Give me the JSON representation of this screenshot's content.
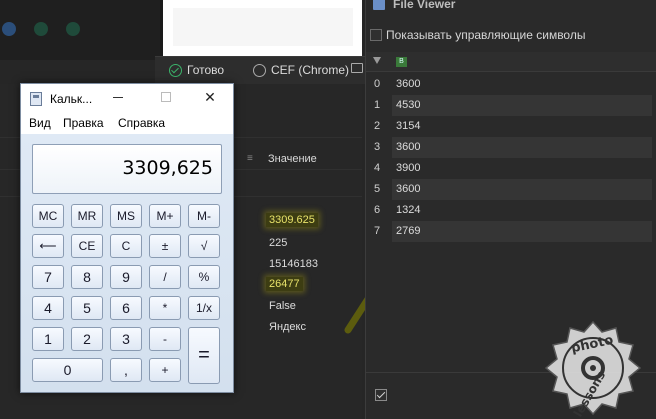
{
  "status_bar": {
    "ready": "Готово",
    "engine": "CEF (Chrome)"
  },
  "background_table": {
    "column_header": "Значение",
    "values": [
      {
        "text": "3309.625",
        "highlighted": true
      },
      {
        "text": "225",
        "highlighted": false
      },
      {
        "text": "15146183",
        "highlighted": false
      },
      {
        "text": "26477",
        "highlighted": true
      },
      {
        "text": "False",
        "highlighted": false
      },
      {
        "text": "Яндекс",
        "highlighted": false
      }
    ]
  },
  "file_viewer": {
    "title": "File Viewer",
    "show_control_chars_label": "Показывать управляющие символы",
    "show_control_chars_checked": false,
    "rows": [
      {
        "index": "0",
        "value": "3600"
      },
      {
        "index": "1",
        "value": "4530"
      },
      {
        "index": "2",
        "value": "3154"
      },
      {
        "index": "3",
        "value": "3600"
      },
      {
        "index": "4",
        "value": "3900"
      },
      {
        "index": "5",
        "value": "3600"
      },
      {
        "index": "6",
        "value": "1324"
      },
      {
        "index": "7",
        "value": "2769"
      }
    ],
    "bottom_checked": true
  },
  "calculator": {
    "title": "Кальк...",
    "menu": [
      "Вид",
      "Правка",
      "Справка"
    ],
    "display": "3309,625",
    "keys": {
      "mc": "MC",
      "mr": "MR",
      "ms": "MS",
      "mplus": "M+",
      "mminus": "M-",
      "backspace": "⟵",
      "ce": "CE",
      "c": "C",
      "plusminus": "±",
      "sqrt": "√",
      "seven": "7",
      "eight": "8",
      "nine": "9",
      "divide": "/",
      "percent": "%",
      "four": "4",
      "five": "5",
      "six": "6",
      "multiply": "*",
      "reciprocal": "1/x",
      "one": "1",
      "two": "2",
      "three": "3",
      "minus": "-",
      "equals": "=",
      "zero": "0",
      "decimal": ",",
      "plus": "+"
    }
  },
  "watermark": {
    "line1": "photo",
    "line2": "lessons"
  },
  "colors": {
    "highlight": "#e8e26a",
    "ok_green": "#3bb36a",
    "scribble": "#6a6a10"
  }
}
